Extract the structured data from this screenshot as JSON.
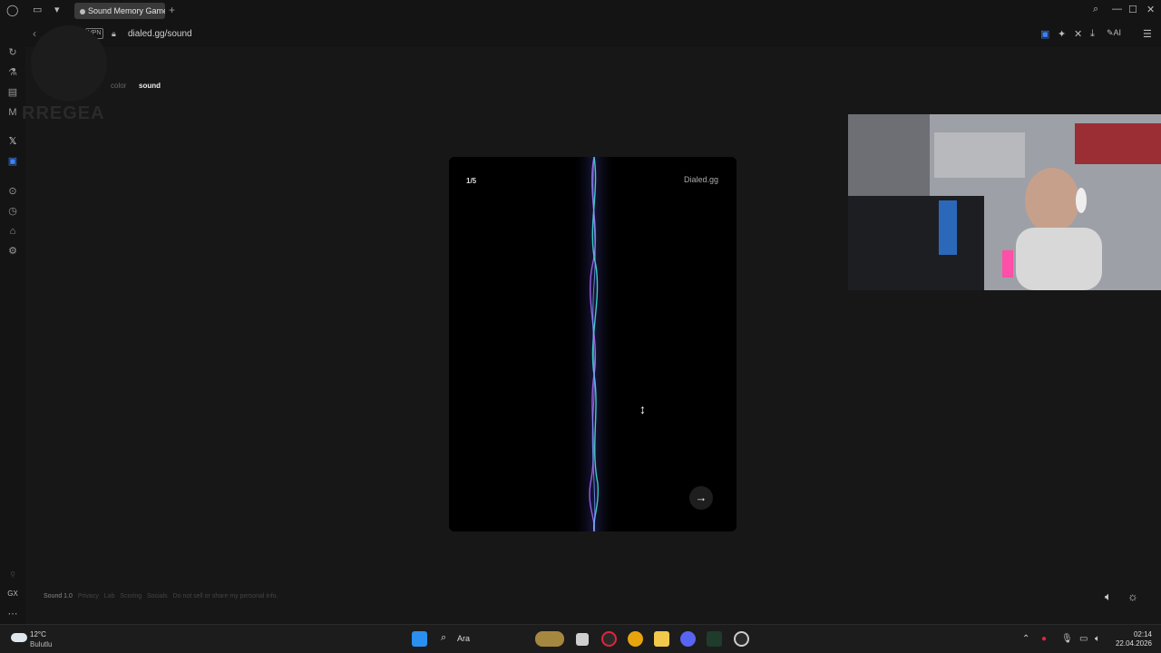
{
  "browser": {
    "tab_title": "Sound Memory Game",
    "new_tab": "+",
    "url": "dialed.gg/sound",
    "vpn_label": "VPN",
    "ai_label": "AI"
  },
  "page": {
    "nav": {
      "color": "color",
      "sound": "sound"
    },
    "card": {
      "counter": "1/5",
      "brand": "Dialed.gg",
      "next_icon": "→"
    },
    "footer": {
      "version": "Sound 1.0",
      "links": [
        "Privacy",
        "Lab",
        "Scoring",
        "Socials",
        "Do not sell or share my personal info."
      ]
    }
  },
  "overlay": {
    "logo_text": "RREGEA"
  },
  "taskbar": {
    "weather_temp": "12°C",
    "weather_desc": "Bulutlu",
    "search": "Ara",
    "time": "02:14",
    "date": "22.04.2026"
  },
  "colors": {
    "accent_wave_1": "#3fe0d0",
    "accent_wave_2": "#7b5cff",
    "accent_wave_3": "#b06cff"
  }
}
